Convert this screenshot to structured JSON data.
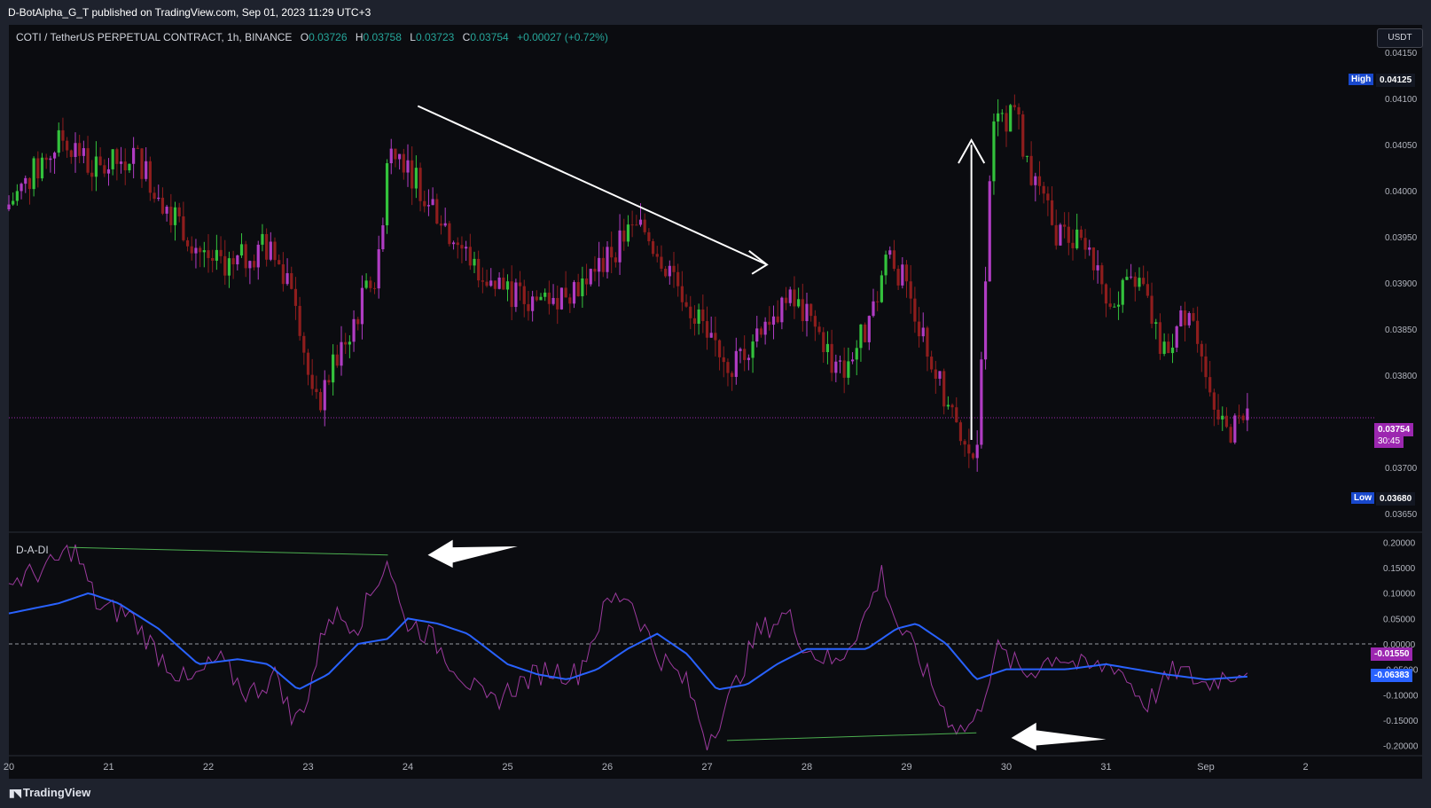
{
  "header": {
    "published_line": "D-BotAlpha_G_T published on TradingView.com, Sep 01, 2023 11:29 UTC+3"
  },
  "legend": {
    "symbol_text": "COTI / TetherUS PERPETUAL CONTRACT, 1h, BINANCE",
    "open_key": "O",
    "open": "0.03726",
    "high_key": "H",
    "high": "0.03758",
    "low_key": "L",
    "low": "0.03723",
    "close_key": "C",
    "close": "0.03754",
    "change": "+0.00027 (+0.72%)"
  },
  "currency_button": "USDT",
  "indicator_label": "D-A-DI",
  "footer": {
    "brand": "TradingView"
  },
  "colors": {
    "background": "#0b0c10",
    "bull_candle": "#33c13c",
    "bear_candle": "#8e1d1d",
    "magenta_candle": "#b03cc3",
    "oscillator_line": "#9c3a9e",
    "signal_line": "#2962ff",
    "divergence_line": "#4caf50",
    "last_price_badge": "#9c27b0",
    "signal_badge": "#2962ff"
  },
  "price_axis": {
    "labels": [
      "0.04150",
      "0.04100",
      "0.04050",
      "0.04000",
      "0.03950",
      "0.03900",
      "0.03850",
      "0.03800",
      "0.03700",
      "0.03650"
    ],
    "high_tag": "High",
    "high_value": "0.04125",
    "low_tag": "Low",
    "low_value": "0.03680",
    "last_price": "0.03754",
    "countdown": "30:45"
  },
  "indicator_axis": {
    "labels": [
      "0.20000",
      "0.15000",
      "0.10000",
      "0.05000",
      "0.00000",
      "-0.05000",
      "-0.10000",
      "-0.15000",
      "-0.20000"
    ],
    "osc_value": "-0.01550",
    "signal_value": "-0.06383"
  },
  "time_axis": {
    "labels": [
      "20",
      "21",
      "22",
      "23",
      "24",
      "25",
      "26",
      "27",
      "28",
      "29",
      "30",
      "31",
      "Sep",
      "2"
    ]
  },
  "chart_data": [
    {
      "type": "candlestick",
      "title": "COTI / TetherUS PERPETUAL CONTRACT, 1h, BINANCE",
      "x_unit": "day of month (Aug 2023 → Sep)",
      "ylim": [
        0.0363,
        0.0418
      ],
      "keypoints": {
        "x": [
          20.0,
          20.6,
          20.9,
          21.3,
          21.6,
          22.0,
          22.3,
          22.6,
          22.9,
          23.1,
          23.5,
          23.75,
          23.85,
          24.2,
          24.5,
          24.8,
          25.2,
          25.6,
          25.9,
          26.2,
          26.4,
          26.7,
          27.0,
          27.3,
          27.6,
          27.9,
          28.2,
          28.35,
          28.7,
          28.85,
          29.1,
          29.4,
          29.6,
          29.75,
          29.9,
          30.1,
          30.3,
          30.5,
          30.8,
          31.1,
          31.4,
          31.6,
          31.9,
          32.1,
          32.3,
          32.45
        ],
        "price": [
          0.0398,
          0.0406,
          0.0402,
          0.0404,
          0.0399,
          0.0393,
          0.0392,
          0.0394,
          0.039,
          0.0376,
          0.0386,
          0.0392,
          0.0406,
          0.04,
          0.0395,
          0.0391,
          0.0388,
          0.0389,
          0.0391,
          0.0395,
          0.0396,
          0.0391,
          0.0385,
          0.0381,
          0.0386,
          0.0388,
          0.0384,
          0.038,
          0.0386,
          0.0394,
          0.0388,
          0.0378,
          0.0372,
          0.0371,
          0.0406,
          0.0409,
          0.0402,
          0.0396,
          0.0394,
          0.0388,
          0.039,
          0.0382,
          0.0388,
          0.0376,
          0.0374,
          0.03754
        ]
      },
      "last_price": 0.03754,
      "high": 0.04125,
      "low": 0.0368
    },
    {
      "type": "line",
      "title": "D-A-DI",
      "ylim": [
        -0.22,
        0.22
      ],
      "series": [
        {
          "x": [
            20.0,
            20.4,
            20.65,
            20.9,
            21.2,
            21.5,
            21.8,
            22.1,
            22.4,
            22.7,
            22.85,
            23.0,
            23.2,
            23.5,
            23.8,
            23.95,
            24.2,
            24.5,
            24.8,
            25.1,
            25.4,
            25.7,
            26.0,
            26.2,
            26.5,
            26.8,
            27.0,
            27.2,
            27.5,
            27.8,
            28.0,
            28.3,
            28.6,
            28.75,
            28.9,
            29.1,
            29.4,
            29.55,
            29.7,
            29.9,
            30.2,
            30.5,
            30.8,
            31.1,
            31.4,
            31.7,
            32.0,
            32.2,
            32.4,
            32.45
          ],
          "y": [
            0.12,
            0.15,
            0.19,
            0.07,
            0.06,
            -0.02,
            -0.08,
            -0.03,
            -0.1,
            -0.06,
            -0.16,
            -0.1,
            0.06,
            0.04,
            0.17,
            0.05,
            0.02,
            -0.05,
            -0.12,
            -0.08,
            -0.05,
            -0.06,
            0.08,
            0.1,
            -0.02,
            -0.08,
            -0.19,
            -0.12,
            0.02,
            0.06,
            -0.01,
            -0.04,
            0.06,
            0.14,
            0.04,
            -0.02,
            -0.14,
            -0.17,
            -0.15,
            -0.01,
            -0.06,
            -0.02,
            -0.05,
            -0.04,
            -0.12,
            -0.05,
            -0.08,
            -0.06,
            -0.05,
            -0.0155
          ]
        },
        {
          "x": [
            20.0,
            20.5,
            20.8,
            21.1,
            21.5,
            21.9,
            22.3,
            22.6,
            22.9,
            23.2,
            23.5,
            23.8,
            24.0,
            24.3,
            24.6,
            25.0,
            25.3,
            25.6,
            25.9,
            26.2,
            26.5,
            26.8,
            27.1,
            27.4,
            27.7,
            28.0,
            28.3,
            28.6,
            28.9,
            29.1,
            29.4,
            29.7,
            30.0,
            30.3,
            30.6,
            31.0,
            31.3,
            31.6,
            32.0,
            32.45
          ],
          "y": [
            0.06,
            0.08,
            0.1,
            0.08,
            0.03,
            -0.04,
            -0.03,
            -0.04,
            -0.09,
            -0.06,
            0.0,
            0.01,
            0.05,
            0.04,
            0.02,
            -0.04,
            -0.06,
            -0.07,
            -0.05,
            -0.01,
            0.02,
            -0.02,
            -0.09,
            -0.08,
            -0.04,
            -0.01,
            -0.01,
            -0.01,
            0.03,
            0.04,
            0.0,
            -0.07,
            -0.05,
            -0.05,
            -0.05,
            -0.04,
            -0.05,
            -0.06,
            -0.07,
            -0.06383
          ]
        }
      ]
    }
  ]
}
